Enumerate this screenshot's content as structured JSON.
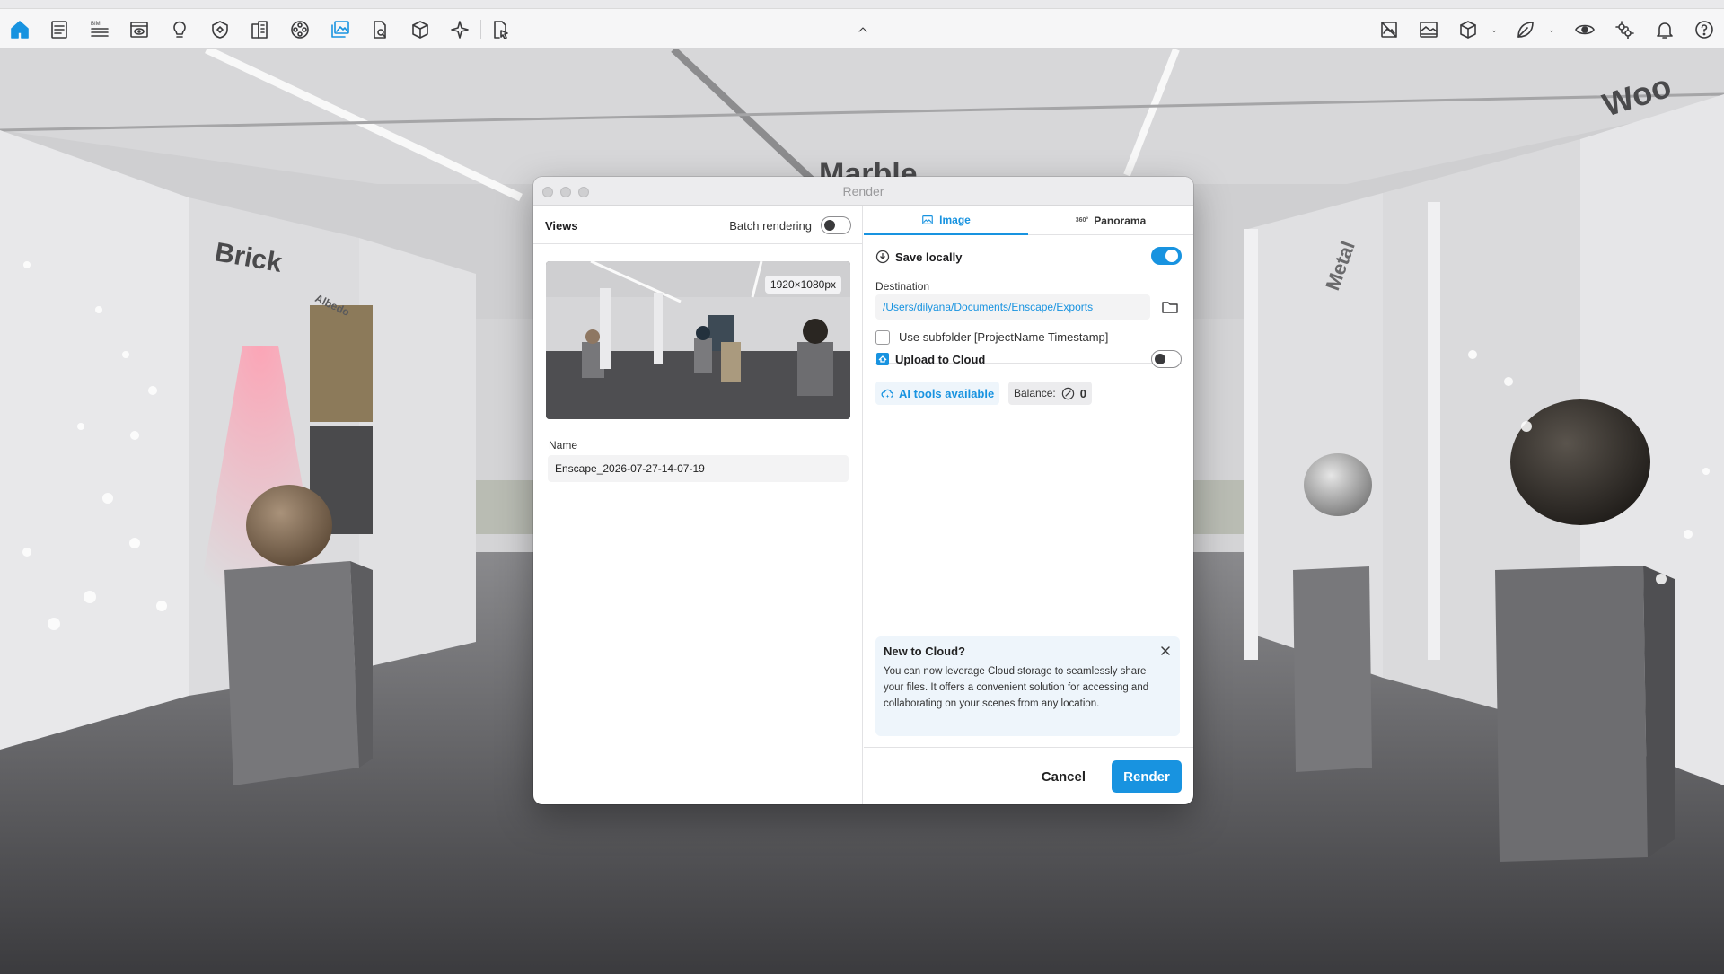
{
  "toolbar": {
    "left_icons": [
      "home-icon",
      "document-icon",
      "bim-icon",
      "view-eye-icon",
      "lightbulb-icon",
      "shield-icon",
      "building-icon",
      "film-reel-icon",
      "render-image-icon",
      "doc-export-icon",
      "cube-icon",
      "sparkle-icon",
      "file-cursor-icon"
    ],
    "bim_label": "BIM",
    "right_icons": [
      "no-image-icon",
      "texture-icon",
      "cube-settings-icon",
      "leaf-icon",
      "eye-icon",
      "gears-icon",
      "bell-icon",
      "help-icon"
    ],
    "accent_color": "#1893e0"
  },
  "scene": {
    "signs": {
      "brick": "Brick",
      "marble": "Marble",
      "wood": "Woo",
      "metal": "Metal",
      "albedo": "Albedo"
    }
  },
  "dialog": {
    "title": "Render",
    "views": {
      "title": "Views",
      "batch_rendering_label": "Batch rendering",
      "batch_rendering_on": false,
      "thumbnail_resolution": "1920×1080px",
      "name_label": "Name",
      "name_value": "Enscape_2026-07-27-14-07-19"
    },
    "tabs": [
      {
        "label": "Image",
        "active": true
      },
      {
        "label": "Panorama",
        "active": false
      }
    ],
    "panorama_badge": "360°",
    "save_locally": {
      "label": "Save locally",
      "enabled": true,
      "destination_label": "Destination",
      "destination_path": "/Users/dilyana/Documents/Enscape/Exports",
      "subfolder_label": "Use subfolder [ProjectName Timestamp]",
      "subfolder_checked": false
    },
    "upload_to_cloud": {
      "label": "Upload to Cloud",
      "enabled": false,
      "ai_tools_label": "AI tools available",
      "balance_label": "Balance:",
      "balance_value": "0"
    },
    "info": {
      "title": "New to Cloud?",
      "text": "You can now leverage Cloud storage to seamlessly share your files. It offers a convenient solution for accessing and collaborating on your scenes from any location."
    },
    "buttons": {
      "cancel": "Cancel",
      "render": "Render"
    }
  }
}
